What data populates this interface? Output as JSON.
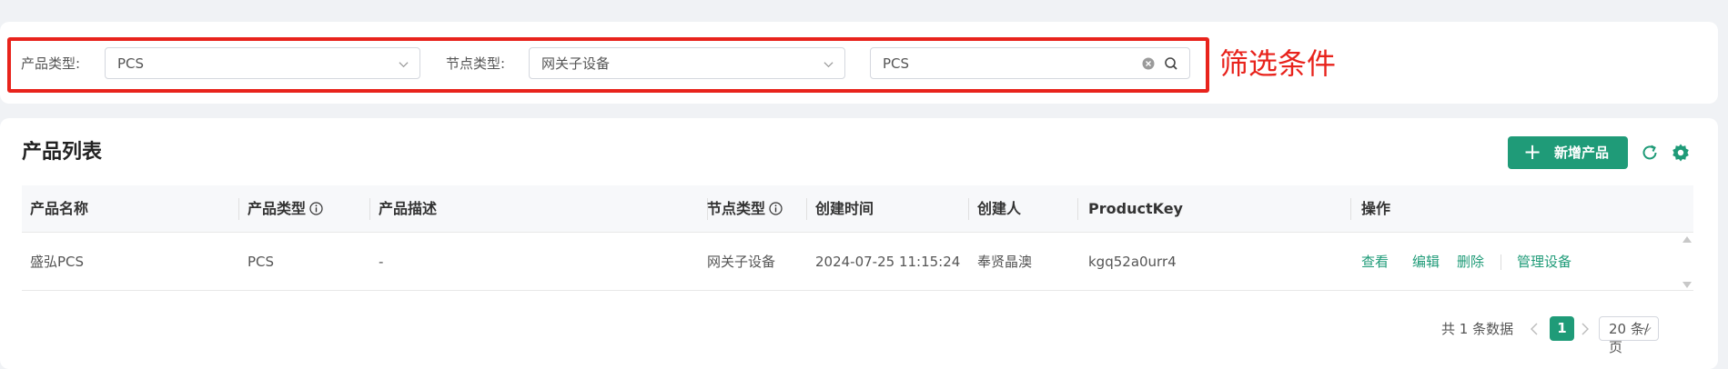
{
  "filters": {
    "product_type_label": "产品类型:",
    "product_type_value": "PCS",
    "node_type_label": "节点类型:",
    "node_type_value": "网关子设备",
    "search_value": "PCS"
  },
  "annotation": "筛选条件",
  "list": {
    "title": "产品列表",
    "add_button": "新增产品",
    "add_icon": "+",
    "columns": [
      "产品名称",
      "产品类型",
      "产品描述",
      "节点类型",
      "创建时间",
      "创建人",
      "ProductKey",
      "操作"
    ],
    "rows": [
      {
        "name": "盛弘PCS",
        "type": "PCS",
        "desc": "-",
        "node_type": "网关子设备",
        "created": "2024-07-25 11:15:24",
        "creator": "奉贤晶澳",
        "product_key": "kgq52a0urr4",
        "actions": [
          "查看",
          "编辑",
          "删除",
          "管理设备"
        ]
      }
    ]
  },
  "pagination": {
    "total_text": "共 1 条数据",
    "current_page": "1",
    "page_size": "20 条/页"
  },
  "colors": {
    "accent": "#1f9b78",
    "highlight": "#e8231c"
  },
  "icons": [
    "chevron-down-icon",
    "clear-icon",
    "search-icon",
    "plus-icon",
    "refresh-icon",
    "settings-icon",
    "info-icon",
    "chevron-left-icon",
    "chevron-right-icon"
  ]
}
